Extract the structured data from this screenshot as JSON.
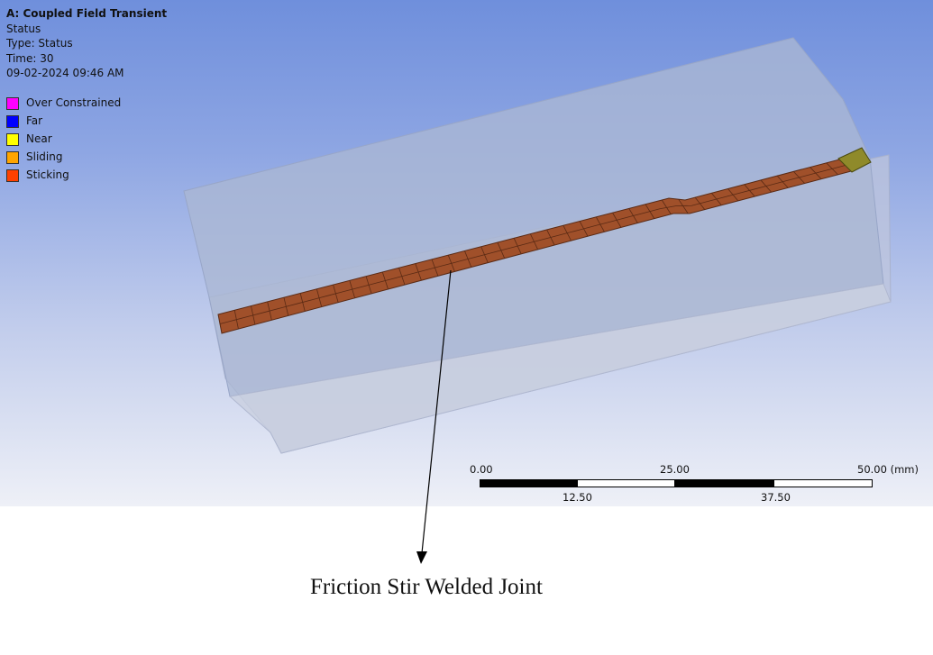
{
  "header": {
    "title": "A: Coupled Field Transient",
    "result": "Status",
    "type": "Type: Status",
    "time": "Time: 30",
    "date": "09-02-2024 09:46 AM"
  },
  "legend": {
    "items": [
      {
        "label": "Over Constrained",
        "color": "#ff00ff"
      },
      {
        "label": "Far",
        "color": "#0000ff"
      },
      {
        "label": "Near",
        "color": "#ffff00"
      },
      {
        "label": "Sliding",
        "color": "#ffa500"
      },
      {
        "label": "Sticking",
        "color": "#ff4000"
      }
    ]
  },
  "scale_bar": {
    "top_labels": [
      "0.00",
      "25.00",
      "50.00 (mm)"
    ],
    "bottom_labels": [
      "12.50",
      "37.50"
    ]
  },
  "weld": {
    "fill_color": "#a0502a",
    "edge_color": "#5a2a14",
    "end_color": "#8f8a2a"
  },
  "annotation": {
    "text": "Friction Stir Welded Joint"
  }
}
